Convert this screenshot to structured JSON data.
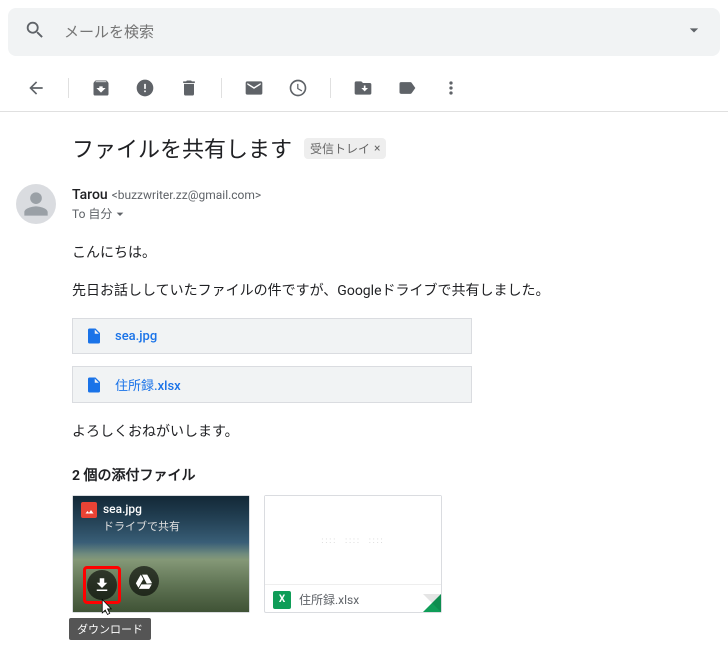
{
  "search": {
    "placeholder": "メールを検索"
  },
  "mail": {
    "subject": "ファイルを共有します",
    "label": "受信トレイ",
    "sender_name": "Tarou",
    "sender_email": "<buzzwriter.zz@gmail.com>",
    "to_prefix": "To",
    "to_target": "自分"
  },
  "body": {
    "greeting": "こんにちは。",
    "line1": "先日お話ししていたファイルの件ですが、Googleドライブで共有しました。",
    "closing": "よろしくおねがいします。"
  },
  "drive_links": [
    {
      "name": "sea.jpg"
    },
    {
      "name": "住所録.xlsx"
    }
  ],
  "attachments": {
    "title": "2 個の添付ファイル",
    "items": [
      {
        "name": "sea.jpg",
        "sub": "ドライブで共有"
      },
      {
        "name": "住所録.xlsx"
      }
    ]
  },
  "tooltip": {
    "download": "ダウンロード"
  }
}
